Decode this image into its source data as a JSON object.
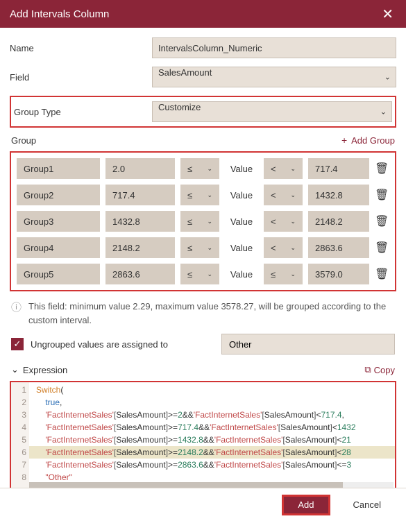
{
  "title": "Add Intervals Column",
  "form": {
    "name_label": "Name",
    "name_value": "IntervalsColumn_Numeric",
    "field_label": "Field",
    "field_value": "SalesAmount",
    "group_type_label": "Group Type",
    "group_type_value": "Customize"
  },
  "group_label": "Group",
  "add_group_label": "Add Group",
  "value_label": "Value",
  "groups": [
    {
      "name": "Group1",
      "from": "2.0",
      "op1": "≤",
      "op2": "<",
      "to": "717.4"
    },
    {
      "name": "Group2",
      "from": "717.4",
      "op1": "≤",
      "op2": "<",
      "to": "1432.8"
    },
    {
      "name": "Group3",
      "from": "1432.8",
      "op1": "≤",
      "op2": "<",
      "to": "2148.2"
    },
    {
      "name": "Group4",
      "from": "2148.2",
      "op1": "≤",
      "op2": "<",
      "to": "2863.6"
    },
    {
      "name": "Group5",
      "from": "2863.6",
      "op1": "≤",
      "op2": "≤",
      "to": "3579.0"
    }
  ],
  "info_text": "This field: minimum value 2.29, maximum value 3578.27, will be grouped according to the custom interval.",
  "ungrouped_label": "Ungrouped values are assigned to",
  "ungrouped_value": "Other",
  "expression_label": "Expression",
  "copy_label": "Copy",
  "code_lines": [
    "Switch(",
    "    true,",
    "    'FactInternetSales'[SalesAmount]>=2&&'FactInternetSales'[SalesAmount]<717.4,",
    "    'FactInternetSales'[SalesAmount]>=717.4&&'FactInternetSales'[SalesAmount]<1432",
    "    'FactInternetSales'[SalesAmount]>=1432.8&&'FactInternetSales'[SalesAmount]<21",
    "    'FactInternetSales'[SalesAmount]>=2148.2&&'FactInternetSales'[SalesAmount]<28",
    "    'FactInternetSales'[SalesAmount]>=2863.6&&'FactInternetSales'[SalesAmount]<=3",
    "    \"Other\""
  ],
  "buttons": {
    "add": "Add",
    "cancel": "Cancel"
  }
}
